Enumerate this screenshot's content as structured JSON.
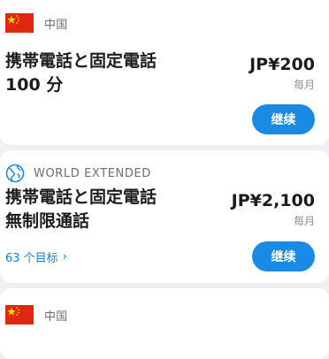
{
  "plans": [
    {
      "region": "中国",
      "title_line1": "携帯電話と固定電話",
      "title_line2": "100 分",
      "price": "JP¥200",
      "period": "毎月",
      "button": "继续"
    },
    {
      "region": "WORLD EXTENDED",
      "title_line1": "携帯電話と固定電話",
      "title_line2": "無制限通話",
      "destinations_link": "63 个目标",
      "price": "JP¥2,100",
      "period": "毎月",
      "button": "继续"
    },
    {
      "region": "中国"
    }
  ],
  "icons": {
    "flag": "china-flag-icon",
    "globe": "globe-icon",
    "chevron": "chevron-right-icon"
  },
  "colors": {
    "accent": "#1a8be5",
    "link": "#1a7fd6",
    "background": "#efeff4",
    "flag_red": "#de2910",
    "flag_yellow": "#ffde00"
  }
}
